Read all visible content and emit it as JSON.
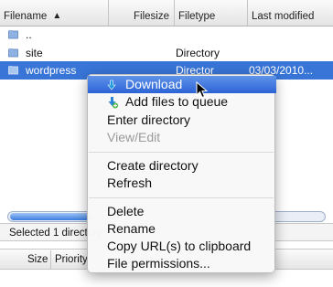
{
  "columns": {
    "filename": "Filename",
    "filesize": "Filesize",
    "filetype": "Filetype",
    "last_modified": "Last modified"
  },
  "rows": [
    {
      "name": "..",
      "type": "",
      "modified": ""
    },
    {
      "name": "site",
      "type": "Directory",
      "modified": ""
    },
    {
      "name": "wordpress",
      "type": "Director",
      "modified": "03/03/2010..."
    }
  ],
  "status": "Selected 1 directory",
  "queue_columns": {
    "size": "Size",
    "priority": "Priority"
  },
  "context_menu": {
    "download": "Download",
    "add_to_queue": "Add files to queue",
    "enter_directory": "Enter directory",
    "view_edit": "View/Edit",
    "create_directory": "Create directory",
    "refresh": "Refresh",
    "delete": "Delete",
    "rename": "Rename",
    "copy_url": "Copy URL(s) to clipboard",
    "file_permissions": "File permissions..."
  },
  "colors": {
    "selection": "#3875d7",
    "menu_highlight": "#2c63d6",
    "folder": "#8fb2e3"
  },
  "icons": {
    "folder": "folder-icon",
    "download": "download-arrow-icon",
    "add": "add-to-queue-icon"
  }
}
